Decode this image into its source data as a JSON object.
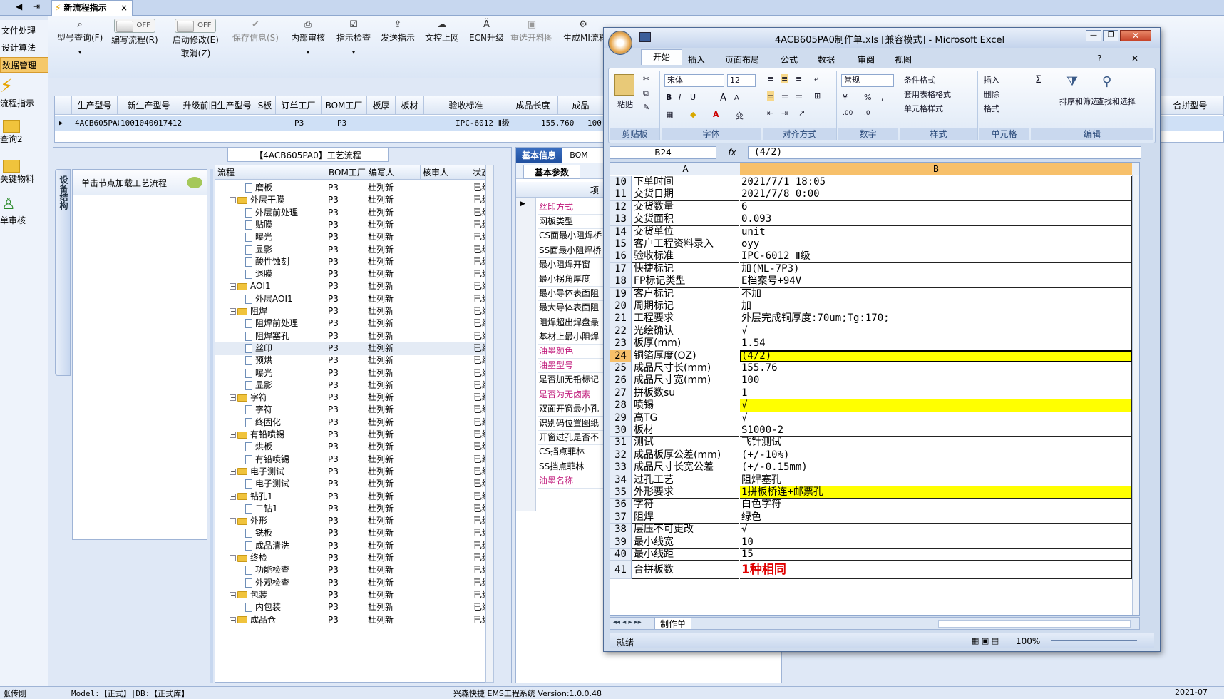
{
  "tabstrip": {
    "active_tab": "新流程指示",
    "close": "×"
  },
  "leftnav": {
    "items": [
      {
        "label": "文件处理"
      },
      {
        "label": "设计算法"
      },
      {
        "label": "数据管理"
      }
    ],
    "big_items": [
      {
        "label": "流程指示"
      },
      {
        "label": "查询2"
      },
      {
        "label": "关键物料"
      },
      {
        "label": "单审核"
      }
    ]
  },
  "toolbar": {
    "buttons": [
      {
        "label": "型号查询(F)",
        "icon": "⌕"
      },
      {
        "label": "编写流程(R)",
        "toggle": "OFF"
      },
      {
        "label": "启动修改(E)",
        "sub": "取消(Z)",
        "toggle": "OFF"
      },
      {
        "label": "保存信息(S)",
        "icon": "✔"
      },
      {
        "label": "内部审核",
        "icon": "⎙"
      },
      {
        "label": "指示检查",
        "icon": "☑"
      },
      {
        "label": "发送指示",
        "icon": "⇪"
      },
      {
        "label": "文控上网",
        "icon": "☁"
      },
      {
        "label": "ECN升级",
        "icon": "Ä"
      },
      {
        "label": "重选开料图",
        "icon": "▣"
      },
      {
        "label": "生成MI流程",
        "icon": "⚙"
      }
    ]
  },
  "topgrid": {
    "headers": [
      "生产型号",
      "新生产型号",
      "升级前旧生产型号",
      "S板",
      "订单工厂",
      "BOM工厂",
      "板厚",
      "板材",
      "验收标准",
      "成品长度",
      "成品",
      "合拼型号"
    ],
    "row": [
      "4ACB605PA0",
      "10010400174125",
      "",
      "",
      "P3",
      "P3",
      "",
      "",
      "IPC-6012 Ⅱ级",
      "155.760",
      "100."
    ]
  },
  "process": {
    "title": "【4ACB605PA0】工艺流程",
    "side_tab": "设备结构",
    "hint": "单击节点加载工艺流程",
    "headers": [
      "流程",
      "BOM工厂",
      "编写人",
      "核审人",
      "状态"
    ],
    "rows": [
      {
        "name": "磨板",
        "level": 2,
        "bom": "P3",
        "writer": "杜列新",
        "status": "已编"
      },
      {
        "name": "外层干膜",
        "level": 1,
        "bom": "P3",
        "writer": "杜列新",
        "status": "已编"
      },
      {
        "name": "外层前处理",
        "level": 2,
        "bom": "P3",
        "writer": "杜列新",
        "status": "已编"
      },
      {
        "name": "贴膜",
        "level": 2,
        "bom": "P3",
        "writer": "杜列新",
        "status": "已编"
      },
      {
        "name": "曝光",
        "level": 2,
        "bom": "P3",
        "writer": "杜列新",
        "status": "已编"
      },
      {
        "name": "显影",
        "level": 2,
        "bom": "P3",
        "writer": "杜列新",
        "status": "已编"
      },
      {
        "name": "酸性蚀刻",
        "level": 2,
        "bom": "P3",
        "writer": "杜列新",
        "status": "已编"
      },
      {
        "name": "退膜",
        "level": 2,
        "bom": "P3",
        "writer": "杜列新",
        "status": "已编"
      },
      {
        "name": "AOI1",
        "level": 1,
        "bom": "P3",
        "writer": "杜列新",
        "status": "已编"
      },
      {
        "name": "外层AOI1",
        "level": 2,
        "bom": "P3",
        "writer": "杜列新",
        "status": "已编"
      },
      {
        "name": "阻焊",
        "level": 1,
        "bom": "P3",
        "writer": "杜列新",
        "status": "已编"
      },
      {
        "name": "阻焊前处理",
        "level": 2,
        "bom": "P3",
        "writer": "杜列新",
        "status": "已编"
      },
      {
        "name": "阻焊塞孔",
        "level": 2,
        "bom": "P3",
        "writer": "杜列新",
        "status": "已编"
      },
      {
        "name": "丝印",
        "level": 2,
        "bom": "P3",
        "writer": "杜列新",
        "status": "已编"
      },
      {
        "name": "预烘",
        "level": 2,
        "bom": "P3",
        "writer": "杜列新",
        "status": "已编"
      },
      {
        "name": "曝光",
        "level": 2,
        "bom": "P3",
        "writer": "杜列新",
        "status": "已编"
      },
      {
        "name": "显影",
        "level": 2,
        "bom": "P3",
        "writer": "杜列新",
        "status": "已编"
      },
      {
        "name": "字符",
        "level": 1,
        "bom": "P3",
        "writer": "杜列新",
        "status": "已编"
      },
      {
        "name": "字符",
        "level": 2,
        "bom": "P3",
        "writer": "杜列新",
        "status": "已编"
      },
      {
        "name": "终固化",
        "level": 2,
        "bom": "P3",
        "writer": "杜列新",
        "status": "已编"
      },
      {
        "name": "有铅喷锡",
        "level": 1,
        "bom": "P3",
        "writer": "杜列新",
        "status": "已编"
      },
      {
        "name": "烘板",
        "level": 2,
        "bom": "P3",
        "writer": "杜列新",
        "status": "已编"
      },
      {
        "name": "有铅喷锡",
        "level": 2,
        "bom": "P3",
        "writer": "杜列新",
        "status": "已编"
      },
      {
        "name": "电子测试",
        "level": 1,
        "bom": "P3",
        "writer": "杜列新",
        "status": "已编"
      },
      {
        "name": "电子测试",
        "level": 2,
        "bom": "P3",
        "writer": "杜列新",
        "status": "已编"
      },
      {
        "name": "钻孔1",
        "level": 1,
        "bom": "P3",
        "writer": "杜列新",
        "status": "已编"
      },
      {
        "name": "二钻1",
        "level": 2,
        "bom": "P3",
        "writer": "杜列新",
        "status": "已编"
      },
      {
        "name": "外形",
        "level": 1,
        "bom": "P3",
        "writer": "杜列新",
        "status": "已编"
      },
      {
        "name": "铣板",
        "level": 2,
        "bom": "P3",
        "writer": "杜列新",
        "status": "已编"
      },
      {
        "name": "成品清洗",
        "level": 2,
        "bom": "P3",
        "writer": "杜列新",
        "status": "已编"
      },
      {
        "name": "终检",
        "level": 1,
        "bom": "P3",
        "writer": "杜列新",
        "status": "已编"
      },
      {
        "name": "功能检查",
        "level": 2,
        "bom": "P3",
        "writer": "杜列新",
        "status": "已编"
      },
      {
        "name": "外观检查",
        "level": 2,
        "bom": "P3",
        "writer": "杜列新",
        "status": "已编"
      },
      {
        "name": "包装",
        "level": 1,
        "bom": "P3",
        "writer": "杜列新",
        "status": "已编"
      },
      {
        "name": "内包装",
        "level": 2,
        "bom": "P3",
        "writer": "杜列新",
        "status": "已编"
      },
      {
        "name": "成品仓",
        "level": 1,
        "bom": "P3",
        "writer": "杜列新",
        "status": "已编"
      }
    ]
  },
  "basic": {
    "tab": "基本信息",
    "tab2": "BOM",
    "subtab": "基本参数",
    "col": "项",
    "rows": [
      {
        "label": "丝印方式",
        "pink": true
      },
      {
        "label": "网板类型",
        "pink": false
      },
      {
        "label": "CS面最小阻焊桥",
        "pink": false
      },
      {
        "label": "SS面最小阻焊桥",
        "pink": false
      },
      {
        "label": "最小阻焊开窗",
        "pink": false
      },
      {
        "label": "最小拐角厚度",
        "pink": false
      },
      {
        "label": "最小导体表面阻",
        "pink": false
      },
      {
        "label": "最大导体表面阻",
        "pink": false
      },
      {
        "label": "阻焊超出焊盘最",
        "pink": false
      },
      {
        "label": "基材上最小阻焊",
        "pink": false
      },
      {
        "label": "油墨颜色",
        "pink": true
      },
      {
        "label": "油墨型号",
        "pink": true
      },
      {
        "label": "是否加无铅标记",
        "pink": false
      },
      {
        "label": "是否为无卤素",
        "pink": true
      },
      {
        "label": "双面开窗最小孔",
        "pink": false
      },
      {
        "label": "识别码位置图纸",
        "pink": false
      },
      {
        "label": "开窗过孔是否不",
        "pink": false
      },
      {
        "label": "CS挡点菲林",
        "pink": false
      },
      {
        "label": "SS挡点菲林",
        "pink": false
      },
      {
        "label": "油墨名称",
        "pink": true
      }
    ]
  },
  "excel": {
    "title": "4ACB605PA0制作单.xls [兼容模式] - Microsoft Excel",
    "tabs": [
      "开始",
      "插入",
      "页面布局",
      "公式",
      "数据",
      "审阅",
      "视图"
    ],
    "ribbon": {
      "clipboard": "剪贴板",
      "paste": "粘贴",
      "font": "字体",
      "font_name": "宋体",
      "font_size": "12",
      "align": "对齐方式",
      "number": "数字",
      "number_fmt": "常规",
      "styles": "样式",
      "cond": "条件格式",
      "table": "套用表格格式",
      "cell_style": "单元格样式",
      "cells": "单元格",
      "insert": "插入",
      "delete": "删除",
      "format": "格式",
      "edit": "编辑",
      "sort": "排序和筛选",
      "find": "查找和选择"
    },
    "namebox": "B24",
    "fx": "fx",
    "formula": "(4/2)",
    "col_a": "A",
    "col_b": "B",
    "rows": [
      {
        "n": "10",
        "a": "下单时间",
        "b": "2021/7/1 18:05"
      },
      {
        "n": "11",
        "a": "交货日期",
        "b": "2021/7/8 0:00"
      },
      {
        "n": "12",
        "a": "交货数量",
        "b": "6"
      },
      {
        "n": "13",
        "a": "交货面积",
        "b": "0.093"
      },
      {
        "n": "14",
        "a": "交货单位",
        "b": "unit"
      },
      {
        "n": "15",
        "a": "客户工程资料录入",
        "b": "oyy"
      },
      {
        "n": "16",
        "a": "验收标准",
        "b": "IPC-6012 Ⅱ级"
      },
      {
        "n": "17",
        "a": "快捷标记",
        "b": "加(ML-7P3)"
      },
      {
        "n": "18",
        "a": "FP标记类型",
        "b": "E档案号+94V"
      },
      {
        "n": "19",
        "a": "客户标记",
        "b": "不加"
      },
      {
        "n": "20",
        "a": "周期标记",
        "b": "加"
      },
      {
        "n": "21",
        "a": "工程要求",
        "b": "外层完成铜厚度:70um;Tg:170;"
      },
      {
        "n": "22",
        "a": "光绘确认",
        "b": "√"
      },
      {
        "n": "23",
        "a": "板厚(mm)",
        "b": "1.54"
      },
      {
        "n": "24",
        "a": "铜箔厚度(OZ)",
        "b": "(4/2)",
        "hl": true
      },
      {
        "n": "25",
        "a": "成品尺寸长(mm)",
        "b": "155.76"
      },
      {
        "n": "26",
        "a": "成品尺寸宽(mm)",
        "b": "100"
      },
      {
        "n": "27",
        "a": "拼板数su",
        "b": "1"
      },
      {
        "n": "28",
        "a": "喷锡",
        "b": "√",
        "hl": true
      },
      {
        "n": "29",
        "a": "高TG",
        "b": "√"
      },
      {
        "n": "30",
        "a": "板材",
        "b": "S1000-2"
      },
      {
        "n": "31",
        "a": "测试",
        "b": "飞针测试"
      },
      {
        "n": "32",
        "a": "成品板厚公差(mm)",
        "b": "(+/-10%)"
      },
      {
        "n": "33",
        "a": "成品尺寸长宽公差",
        "b": "(+/-0.15mm)"
      },
      {
        "n": "34",
        "a": "过孔工艺",
        "b": "阻焊塞孔"
      },
      {
        "n": "35",
        "a": "外形要求",
        "b": "1拼板桥连+邮票孔",
        "hl": true
      },
      {
        "n": "36",
        "a": "字符",
        "b": "白色字符"
      },
      {
        "n": "37",
        "a": "阻焊",
        "b": "绿色"
      },
      {
        "n": "38",
        "a": "层压不可更改",
        "b": "√"
      },
      {
        "n": "39",
        "a": "最小线宽",
        "b": "10"
      },
      {
        "n": "40",
        "a": "最小线距",
        "b": "15"
      },
      {
        "n": "41",
        "a": "合拼板数",
        "b": "1种相同",
        "red": true
      }
    ],
    "sheet_tab": "制作单",
    "status": "就绪",
    "zoom": "100%"
  },
  "statusbar": {
    "user": "张传刚",
    "model": "Model:【正式】|DB:【正式库】",
    "system": "兴森快捷 EMS工程系统 Version:1.0.0.48",
    "date": "2021-07"
  }
}
